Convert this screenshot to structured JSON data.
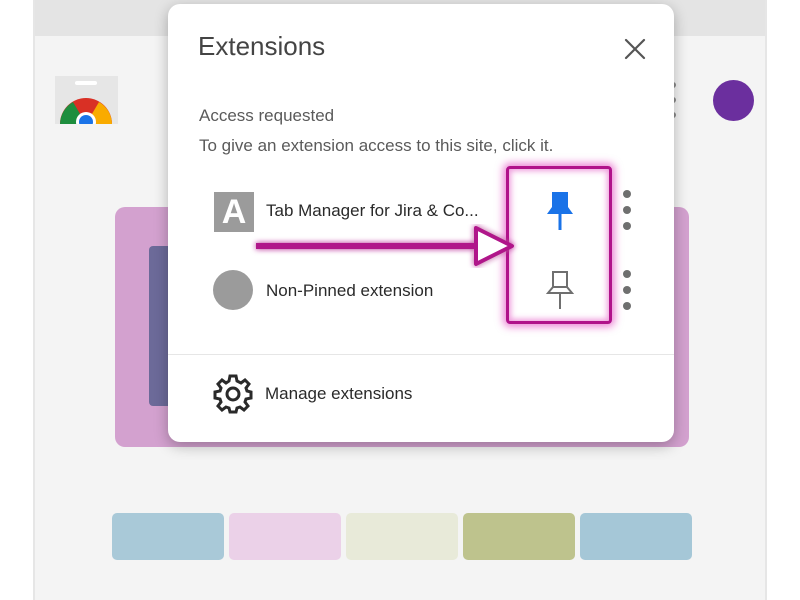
{
  "popup": {
    "title": "Extensions",
    "close_icon": "close-icon",
    "access_section": {
      "title": "Access requested",
      "description": "To give an extension access to this site, click it."
    },
    "extensions": [
      {
        "name": "Tab Manager for Jira & Co...",
        "icon": "letter-a-icon",
        "pinned": true,
        "pin_color": "#1a73e8"
      },
      {
        "name": "Non-Pinned extension",
        "icon": "gray-circle-icon",
        "pinned": false,
        "pin_color": "#6f6f6f"
      }
    ],
    "manage": {
      "label": "Manage extensions",
      "icon": "gear-icon"
    }
  },
  "colors": {
    "highlight": "#b0128a",
    "profile_avatar": "#6b2f9e",
    "hero_card": "#d3a1cf",
    "swatches": [
      "#a9c9d8",
      "#ebd1e8",
      "#e8ead9",
      "#bec38d",
      "#a5c7d7"
    ]
  }
}
